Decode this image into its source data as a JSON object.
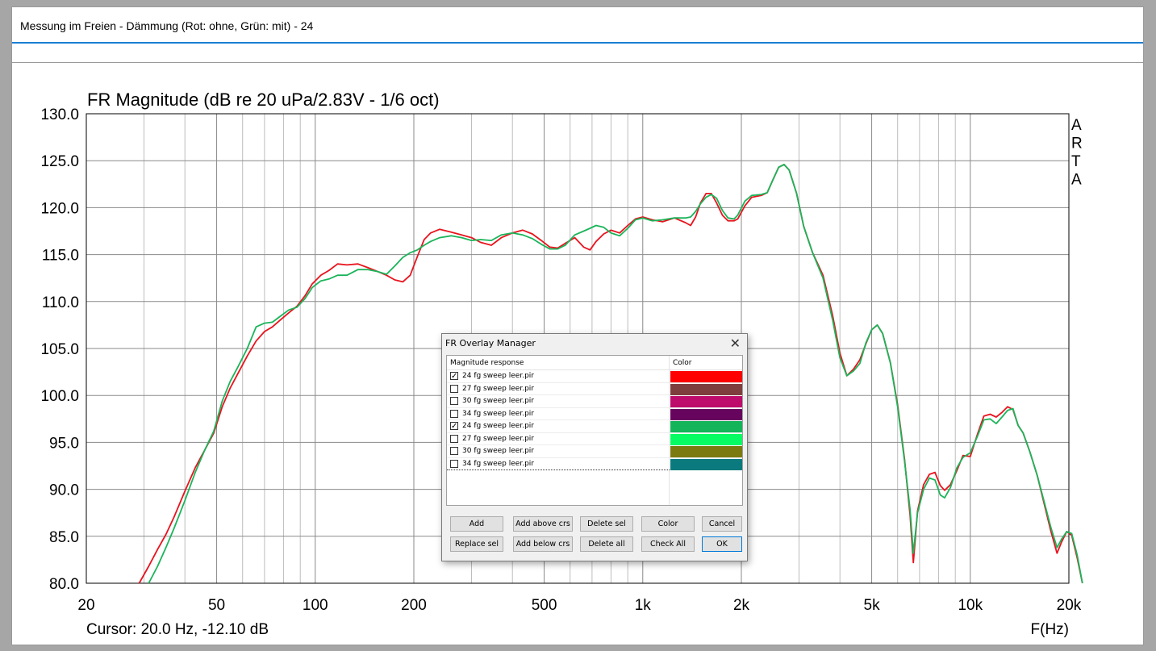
{
  "window": {
    "title": "Messung im Freien - Dämmung (Rot: ohne, Grün: mit) - 24"
  },
  "chart_data": {
    "type": "line",
    "title": "FR Magnitude (dB re 20 uPa/2.83V - 1/6 oct)",
    "xlabel": "F(Hz)",
    "ylabel": "",
    "xscale": "log",
    "xlim": [
      20,
      20000
    ],
    "ylim": [
      80,
      130
    ],
    "grid": true,
    "x_tick_labels": [
      "20",
      "50",
      "100",
      "200",
      "500",
      "1k",
      "2k",
      "5k",
      "10k",
      "20k"
    ],
    "x_tick_values": [
      20,
      50,
      100,
      200,
      500,
      1000,
      2000,
      5000,
      10000,
      20000
    ],
    "y_tick_labels": [
      "130.0",
      "125.0",
      "120.0",
      "115.0",
      "110.0",
      "105.0",
      "100.0",
      "95.0",
      "90.0",
      "85.0",
      "80.0"
    ],
    "y_tick_values": [
      130,
      125,
      120,
      115,
      110,
      105,
      100,
      95,
      90,
      85,
      80
    ],
    "brand_text": [
      "A",
      "R",
      "T",
      "A"
    ],
    "cursor_text": "Cursor: 20.0 Hz, -12.10 dB",
    "series": [
      {
        "color": "#e8141e",
        "points": [
          [
            29,
            80.0
          ],
          [
            31,
            81.8
          ],
          [
            33,
            83.6
          ],
          [
            35,
            85.2
          ],
          [
            37,
            87.0
          ],
          [
            40,
            89.8
          ],
          [
            43,
            92.3
          ],
          [
            46,
            94.2
          ],
          [
            49,
            96.0
          ],
          [
            52,
            98.8
          ],
          [
            55,
            100.8
          ],
          [
            58,
            102.3
          ],
          [
            62,
            104.2
          ],
          [
            66,
            105.8
          ],
          [
            70,
            106.8
          ],
          [
            74,
            107.3
          ],
          [
            78,
            108.0
          ],
          [
            83,
            108.8
          ],
          [
            88,
            109.5
          ],
          [
            93,
            110.6
          ],
          [
            98,
            111.9
          ],
          [
            104,
            112.8
          ],
          [
            110,
            113.3
          ],
          [
            117,
            114.0
          ],
          [
            125,
            113.9
          ],
          [
            135,
            114.0
          ],
          [
            145,
            113.6
          ],
          [
            155,
            113.2
          ],
          [
            165,
            112.8
          ],
          [
            175,
            112.3
          ],
          [
            185,
            112.1
          ],
          [
            195,
            112.8
          ],
          [
            205,
            114.8
          ],
          [
            215,
            116.6
          ],
          [
            225,
            117.3
          ],
          [
            240,
            117.7
          ],
          [
            260,
            117.4
          ],
          [
            280,
            117.1
          ],
          [
            300,
            116.8
          ],
          [
            320,
            116.3
          ],
          [
            345,
            116.0
          ],
          [
            370,
            116.8
          ],
          [
            400,
            117.3
          ],
          [
            430,
            117.6
          ],
          [
            460,
            117.2
          ],
          [
            490,
            116.5
          ],
          [
            520,
            115.8
          ],
          [
            550,
            115.7
          ],
          [
            580,
            116.2
          ],
          [
            620,
            116.8
          ],
          [
            660,
            115.8
          ],
          [
            690,
            115.5
          ],
          [
            720,
            116.4
          ],
          [
            760,
            117.2
          ],
          [
            800,
            117.6
          ],
          [
            850,
            117.3
          ],
          [
            900,
            118.1
          ],
          [
            950,
            118.8
          ],
          [
            1000,
            119.0
          ],
          [
            1070,
            118.7
          ],
          [
            1150,
            118.5
          ],
          [
            1250,
            118.9
          ],
          [
            1350,
            118.4
          ],
          [
            1400,
            118.1
          ],
          [
            1450,
            119.0
          ],
          [
            1500,
            120.5
          ],
          [
            1560,
            121.5
          ],
          [
            1620,
            121.5
          ],
          [
            1680,
            120.5
          ],
          [
            1750,
            119.2
          ],
          [
            1820,
            118.6
          ],
          [
            1900,
            118.6
          ],
          [
            1950,
            118.8
          ],
          [
            2050,
            120.2
          ],
          [
            2150,
            121.1
          ],
          [
            2300,
            121.3
          ],
          [
            2400,
            121.6
          ],
          [
            2500,
            123.0
          ],
          [
            2600,
            124.3
          ],
          [
            2700,
            124.6
          ],
          [
            2800,
            124.0
          ],
          [
            2950,
            121.5
          ],
          [
            3100,
            118.0
          ],
          [
            3300,
            115.2
          ],
          [
            3550,
            112.8
          ],
          [
            3800,
            108.5
          ],
          [
            4000,
            104.5
          ],
          [
            4200,
            102.1
          ],
          [
            4400,
            102.8
          ],
          [
            4600,
            103.8
          ],
          [
            4800,
            105.5
          ],
          [
            5000,
            107.0
          ],
          [
            5200,
            107.5
          ],
          [
            5400,
            106.6
          ],
          [
            5700,
            103.5
          ],
          [
            6000,
            99.0
          ],
          [
            6300,
            93.2
          ],
          [
            6550,
            87.2
          ],
          [
            6700,
            82.2
          ],
          [
            6900,
            87.7
          ],
          [
            7200,
            90.5
          ],
          [
            7500,
            91.6
          ],
          [
            7800,
            91.8
          ],
          [
            8100,
            90.4
          ],
          [
            8350,
            89.9
          ],
          [
            8700,
            90.5
          ],
          [
            9100,
            92.0
          ],
          [
            9500,
            93.6
          ],
          [
            10000,
            93.5
          ],
          [
            10500,
            95.8
          ],
          [
            11000,
            97.8
          ],
          [
            11500,
            98.0
          ],
          [
            12000,
            97.7
          ],
          [
            12500,
            98.2
          ],
          [
            13000,
            98.8
          ],
          [
            13500,
            98.5
          ],
          [
            14000,
            96.8
          ],
          [
            14500,
            96.0
          ],
          [
            15200,
            94.0
          ],
          [
            16000,
            91.5
          ],
          [
            16800,
            88.5
          ],
          [
            17600,
            85.6
          ],
          [
            18400,
            83.2
          ],
          [
            19000,
            84.4
          ],
          [
            19700,
            85.5
          ],
          [
            20400,
            85.1
          ],
          [
            21200,
            82.7
          ],
          [
            22000,
            80.0
          ]
        ]
      },
      {
        "color": "#1bb45a",
        "points": [
          [
            31,
            80.0
          ],
          [
            33,
            81.8
          ],
          [
            35,
            83.8
          ],
          [
            37,
            85.8
          ],
          [
            40,
            88.8
          ],
          [
            43,
            91.8
          ],
          [
            46,
            94.2
          ],
          [
            49,
            96.2
          ],
          [
            52,
            99.4
          ],
          [
            55,
            101.5
          ],
          [
            58,
            103.0
          ],
          [
            62,
            105.0
          ],
          [
            66,
            107.3
          ],
          [
            70,
            107.7
          ],
          [
            74,
            107.8
          ],
          [
            78,
            108.4
          ],
          [
            83,
            109.1
          ],
          [
            88,
            109.4
          ],
          [
            93,
            110.3
          ],
          [
            98,
            111.5
          ],
          [
            104,
            112.2
          ],
          [
            110,
            112.4
          ],
          [
            117,
            112.8
          ],
          [
            125,
            112.8
          ],
          [
            135,
            113.4
          ],
          [
            145,
            113.4
          ],
          [
            155,
            113.2
          ],
          [
            165,
            112.9
          ],
          [
            175,
            113.8
          ],
          [
            185,
            114.7
          ],
          [
            195,
            115.2
          ],
          [
            205,
            115.5
          ],
          [
            215,
            116.0
          ],
          [
            225,
            116.4
          ],
          [
            240,
            116.8
          ],
          [
            260,
            117.0
          ],
          [
            280,
            116.8
          ],
          [
            300,
            116.5
          ],
          [
            320,
            116.6
          ],
          [
            345,
            116.5
          ],
          [
            370,
            117.1
          ],
          [
            400,
            117.3
          ],
          [
            430,
            117.1
          ],
          [
            460,
            116.7
          ],
          [
            490,
            116.1
          ],
          [
            520,
            115.6
          ],
          [
            550,
            115.6
          ],
          [
            580,
            116.0
          ],
          [
            620,
            117.1
          ],
          [
            660,
            117.5
          ],
          [
            690,
            117.8
          ],
          [
            720,
            118.1
          ],
          [
            760,
            117.9
          ],
          [
            800,
            117.3
          ],
          [
            850,
            117.0
          ],
          [
            900,
            117.8
          ],
          [
            950,
            118.7
          ],
          [
            1000,
            118.9
          ],
          [
            1070,
            118.6
          ],
          [
            1150,
            118.7
          ],
          [
            1250,
            118.9
          ],
          [
            1350,
            118.9
          ],
          [
            1400,
            119.0
          ],
          [
            1450,
            119.6
          ],
          [
            1500,
            120.4
          ],
          [
            1560,
            121.1
          ],
          [
            1620,
            121.4
          ],
          [
            1680,
            121.0
          ],
          [
            1750,
            119.7
          ],
          [
            1820,
            118.9
          ],
          [
            1900,
            118.8
          ],
          [
            1950,
            119.2
          ],
          [
            2050,
            120.7
          ],
          [
            2150,
            121.3
          ],
          [
            2300,
            121.4
          ],
          [
            2400,
            121.6
          ],
          [
            2500,
            123.0
          ],
          [
            2600,
            124.3
          ],
          [
            2700,
            124.6
          ],
          [
            2800,
            124.0
          ],
          [
            2950,
            121.5
          ],
          [
            3100,
            118.0
          ],
          [
            3300,
            115.2
          ],
          [
            3550,
            112.5
          ],
          [
            3800,
            108.0
          ],
          [
            4000,
            104.0
          ],
          [
            4200,
            102.1
          ],
          [
            4400,
            102.6
          ],
          [
            4600,
            103.4
          ],
          [
            4800,
            105.6
          ],
          [
            5000,
            107.0
          ],
          [
            5200,
            107.5
          ],
          [
            5400,
            106.6
          ],
          [
            5700,
            103.5
          ],
          [
            6000,
            98.8
          ],
          [
            6300,
            93.0
          ],
          [
            6550,
            87.8
          ],
          [
            6700,
            83.2
          ],
          [
            6900,
            87.5
          ],
          [
            7200,
            90.0
          ],
          [
            7500,
            91.2
          ],
          [
            7800,
            91.0
          ],
          [
            8100,
            89.4
          ],
          [
            8350,
            89.1
          ],
          [
            8700,
            90.2
          ],
          [
            9100,
            92.3
          ],
          [
            9500,
            93.4
          ],
          [
            10000,
            93.9
          ],
          [
            10500,
            95.6
          ],
          [
            11000,
            97.4
          ],
          [
            11500,
            97.5
          ],
          [
            12000,
            97.0
          ],
          [
            12500,
            97.7
          ],
          [
            13000,
            98.4
          ],
          [
            13500,
            98.6
          ],
          [
            14000,
            96.8
          ],
          [
            14500,
            96.0
          ],
          [
            15200,
            94.0
          ],
          [
            16000,
            91.5
          ],
          [
            16800,
            88.7
          ],
          [
            17600,
            86.0
          ],
          [
            18400,
            83.8
          ],
          [
            19000,
            84.7
          ],
          [
            19700,
            85.5
          ],
          [
            20400,
            85.3
          ],
          [
            21200,
            83.0
          ],
          [
            22000,
            80.0
          ]
        ]
      }
    ]
  },
  "dialog": {
    "title": "FR Overlay Manager",
    "close_glyph": "✕",
    "header_magnitude": "Magnitude response",
    "header_color": "Color",
    "rows": [
      {
        "label": "24 fg sweep leer.pir",
        "checked": true,
        "color": "#ff0000"
      },
      {
        "label": "27 fg sweep leer.pir",
        "checked": false,
        "color": "#7f3e3e"
      },
      {
        "label": "30 fg sweep leer.pir",
        "checked": false,
        "color": "#bd0c6c"
      },
      {
        "label": "34 fg sweep leer.pir",
        "checked": false,
        "color": "#66045e"
      },
      {
        "label": "24 fg sweep leer.pir",
        "checked": true,
        "color": "#13b45a"
      },
      {
        "label": "27 fg sweep leer.pir",
        "checked": false,
        "color": "#06fc62"
      },
      {
        "label": "30 fg sweep leer.pir",
        "checked": false,
        "color": "#7b7a10"
      },
      {
        "label": "34 fg sweep leer.pir",
        "checked": false,
        "color": "#0a7a7e"
      }
    ],
    "buttons": {
      "add": "Add",
      "add_above": "Add above crs",
      "delete_sel": "Delete sel",
      "color": "Color",
      "cancel": "Cancel",
      "replace_sel": "Replace sel",
      "add_below": "Add below crs",
      "delete_all": "Delete all",
      "check_all": "Check All",
      "ok": "OK"
    }
  }
}
